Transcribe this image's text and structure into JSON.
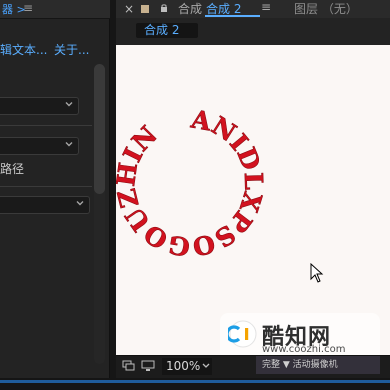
{
  "left_panel": {
    "title": "器 >",
    "menu_icon": "≡",
    "tabs": {
      "edit": "辑文本...",
      "about": "关于..."
    },
    "path_label": "路径"
  },
  "comp_panel": {
    "close_glyph": "×",
    "title_dim": "合成",
    "title_active": "合成 2",
    "menu_icon": "≡",
    "layer_title": "图层 （无）",
    "subtab": "合成 2"
  },
  "canvas": {
    "circle_text": "ANIDLXPSOGOUZHIN"
  },
  "watermark": {
    "name": "酷知网",
    "url": "www.coozhi.com"
  },
  "footer": {
    "zoom_value": "100%",
    "status_text": "完整 ▼   活动摄像机"
  },
  "colors": {
    "accent": "#5aaeff",
    "text_red": "#d2121f",
    "canvas_bg": "#fbf7f5"
  }
}
